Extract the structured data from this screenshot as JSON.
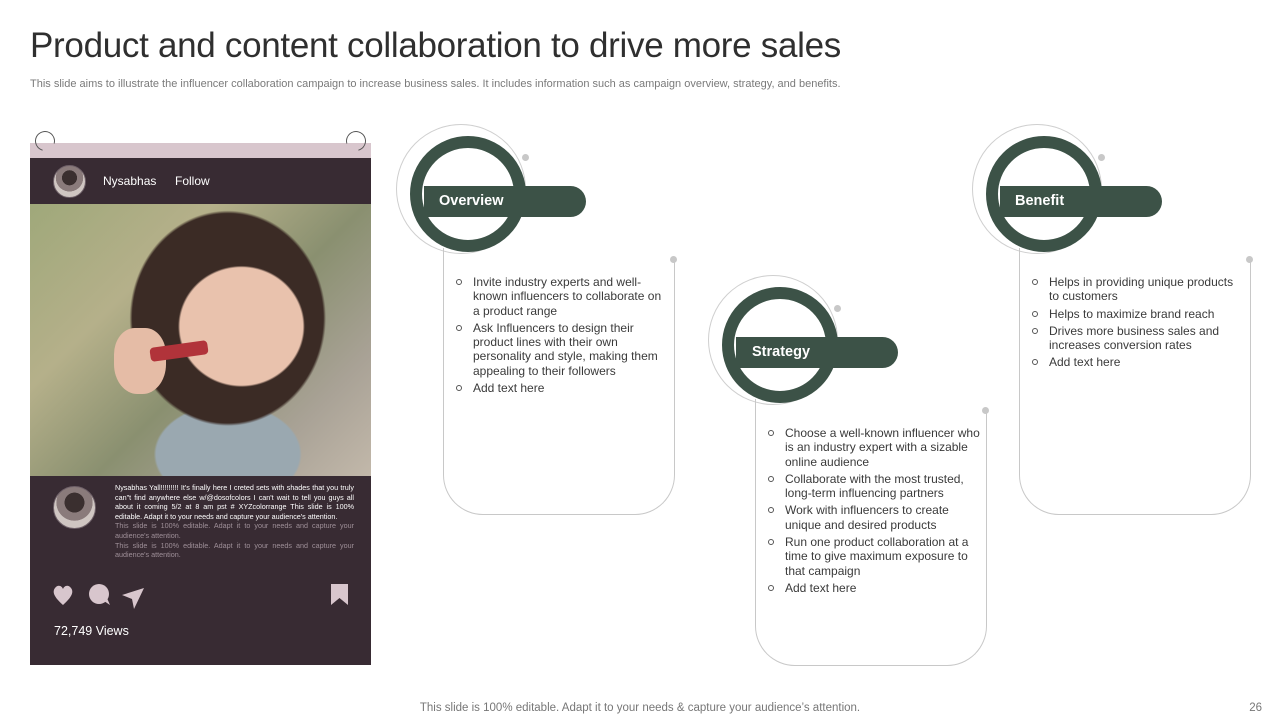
{
  "slide": {
    "title": "Product and content collaboration to drive more sales",
    "subtitle": "This slide aims to illustrate the influencer collaboration campaign to increase business sales. It includes information such as campaign overview, strategy,  and benefits.",
    "footer": "This slide is 100% editable. Adapt it to your needs & capture your audience’s attention.",
    "page_number": "26"
  },
  "phone": {
    "username": "Nysabhas",
    "follow_label": "Follow",
    "caption_main": "Nysabhas Yall!!!!!!!!! It's finally here I creted sets with shades that you truly can\"t find anywhere else w/@dosofcolors I can't wait to tell you guys all about it coming 5/2 at 8 am pst # XYZcolorrange This slide is 100% editable. Adapt it to your needs and capture your audience's attention.",
    "caption_dim_1": "This slide is 100% editable. Adapt it to your needs and capture your audience's attention.",
    "caption_dim_2": "This slide is 100% editable. Adapt it to your needs and capture your audience's attention.",
    "views": "72,749 Views",
    "icons": [
      "heart-icon",
      "comment-icon",
      "send-icon",
      "bookmark-icon"
    ]
  },
  "sections": {
    "overview": {
      "label": "Overview",
      "items": [
        "Invite industry experts and well-known influencers to collaborate on a product range",
        "Ask Influencers to design their product lines with their own personality and style, making them appealing to their followers",
        "Add text here"
      ]
    },
    "strategy": {
      "label": "Strategy",
      "items": [
        "Choose a well-known influencer who is an industry expert with a sizable online audience",
        "Collaborate with the most trusted, long-term influencing partners",
        "Work with influencers to create unique and desired products",
        "Run one product collaboration at a time to give maximum exposure to that campaign",
        "Add text here"
      ]
    },
    "benefit": {
      "label": "Benefit",
      "items": [
        "Helps in providing unique products to customers",
        "Helps to maximize brand reach",
        "Drives more business sales and increases conversion rates",
        "Add text here"
      ]
    }
  },
  "colors": {
    "accent_green": "#3c5247",
    "phone_bg": "#382b33",
    "phone_band": "#d8c6cd"
  }
}
